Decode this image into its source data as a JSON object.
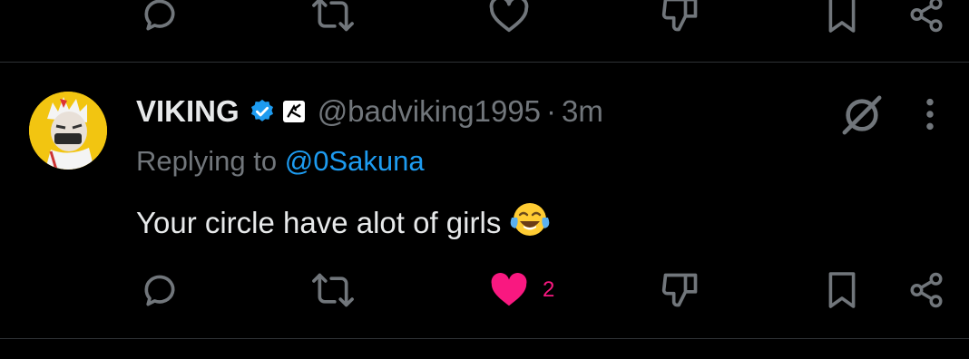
{
  "top_actions": {
    "icons": [
      "reply-icon",
      "retweet-icon",
      "like-icon",
      "dislike-icon",
      "bookmark-icon",
      "share-icon"
    ]
  },
  "tweet": {
    "display_name": "VIKING",
    "handle": "@badviking1995",
    "separator": "·",
    "time": "3m",
    "replying_prefix": "Replying to",
    "replying_to": "@0Sakuna",
    "text": "Your circle have alot of girls",
    "emoji": "face-with-tears-of-joy",
    "like_count": "2",
    "liked": true
  },
  "colors": {
    "background": "#000000",
    "text": "#e7e9ea",
    "muted": "#71767b",
    "link": "#1d9bf0",
    "like": "#f91880",
    "verified": "#1d9bf0",
    "avatar_bg": "#f2c511"
  }
}
